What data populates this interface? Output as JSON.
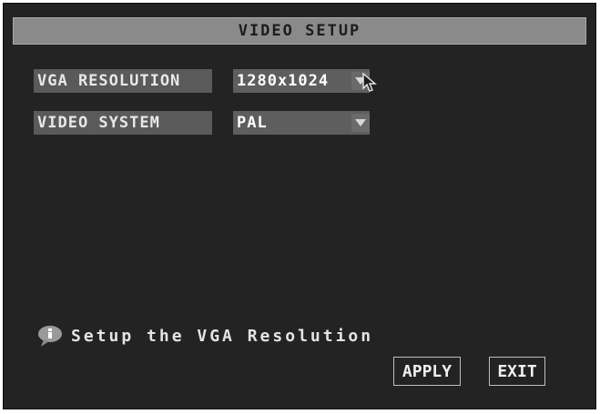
{
  "title": "VIDEO SETUP",
  "settings": [
    {
      "label": "VGA RESOLUTION",
      "value": "1280x1024"
    },
    {
      "label": "VIDEO SYSTEM",
      "value": "PAL"
    }
  ],
  "tip": {
    "icon": "info-bubble-icon",
    "text": "Setup the VGA Resolution"
  },
  "buttons": {
    "apply": "APPLY",
    "exit": "EXIT"
  }
}
